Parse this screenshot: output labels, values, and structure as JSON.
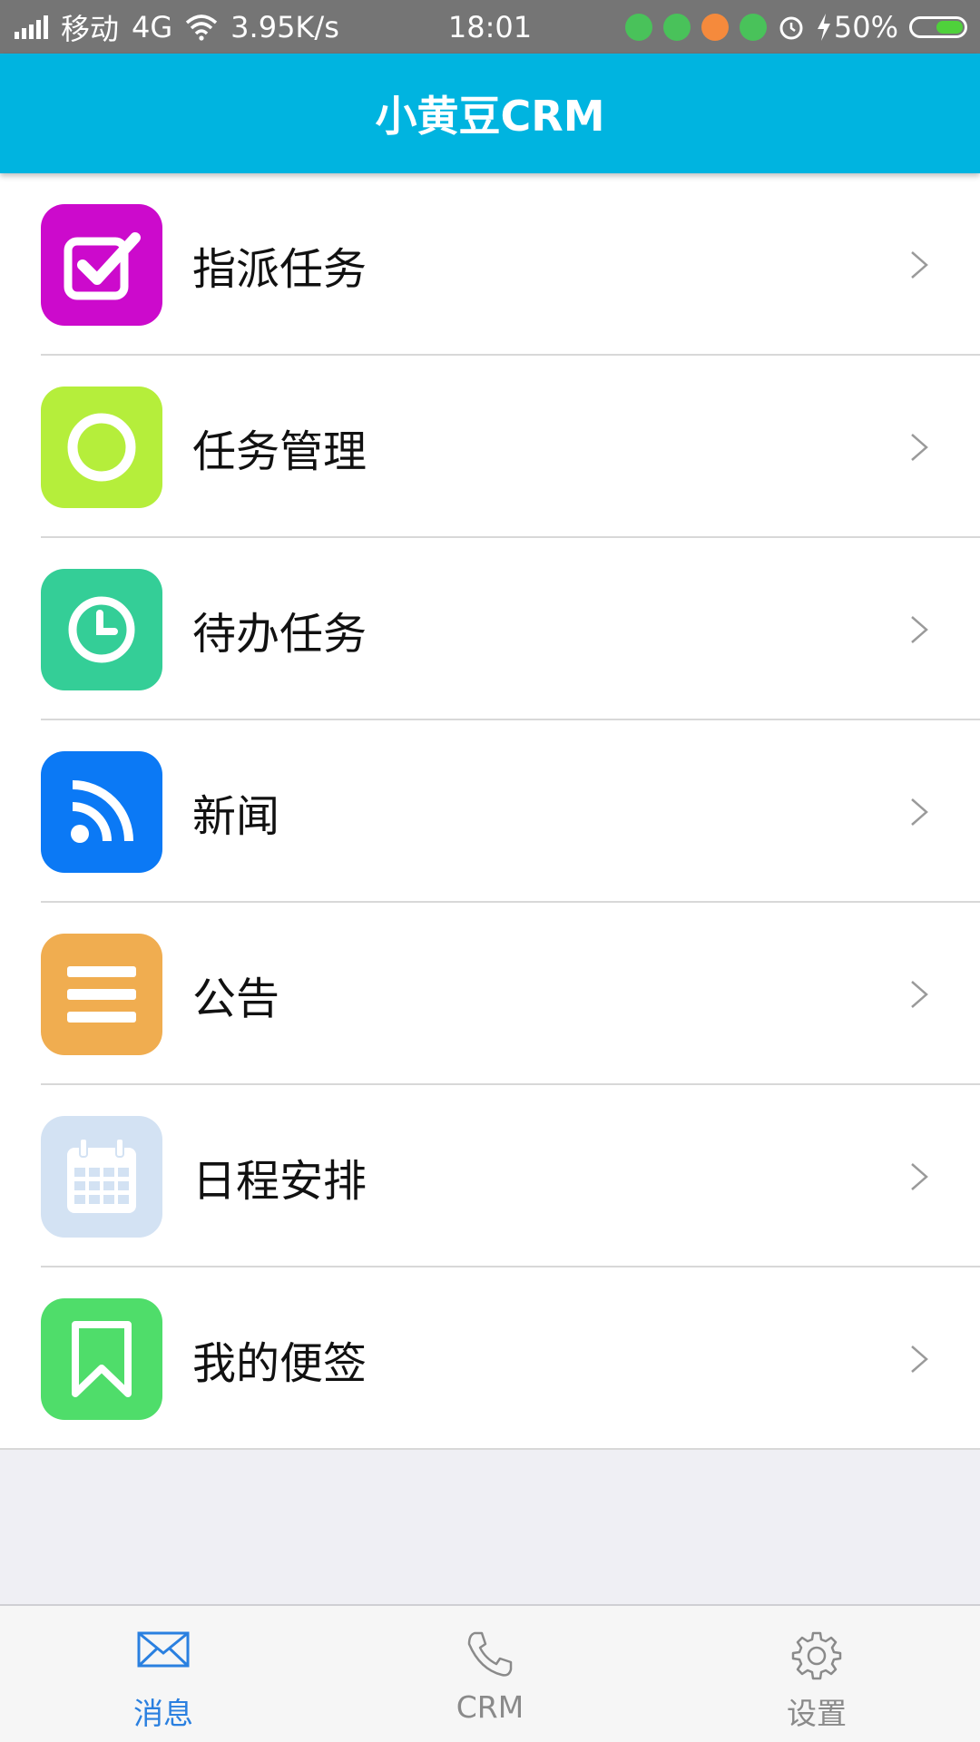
{
  "status_bar": {
    "carrier": "移动",
    "network": "4G",
    "speed": "3.95K/s",
    "time": "18:01",
    "battery": "50%",
    "battery_level": 0.5,
    "icons": [
      "signal-icon",
      "wifi-icon",
      "android-notif-icon",
      "battery-notif-icon",
      "orange-app-icon",
      "android-notif-icon",
      "alarm-icon",
      "charging-icon",
      "battery-icon"
    ]
  },
  "header": {
    "title": "小黄豆CRM"
  },
  "menu": [
    {
      "label": "指派任务",
      "icon": "checkbox-icon",
      "color": "#cc0acc"
    },
    {
      "label": "任务管理",
      "icon": "ring-icon",
      "color": "#b5ee3b"
    },
    {
      "label": "待办任务",
      "icon": "clock-icon",
      "color": "#34ce97"
    },
    {
      "label": "新闻",
      "icon": "rss-icon",
      "color": "#0b79f5"
    },
    {
      "label": "公告",
      "icon": "list-icon",
      "color": "#f0ad50"
    },
    {
      "label": "日程安排",
      "icon": "calendar-icon",
      "color": "#d3e2f3"
    },
    {
      "label": "我的便签",
      "icon": "bookmark-icon",
      "color": "#4fdd6a"
    }
  ],
  "tabs": [
    {
      "label": "消息",
      "icon": "mail-icon",
      "active": true
    },
    {
      "label": "CRM",
      "icon": "phone-icon",
      "active": false
    },
    {
      "label": "设置",
      "icon": "gear-icon",
      "active": false
    }
  ],
  "colors": {
    "accent": "#00b4e0",
    "tab_active": "#2a80e0",
    "tab_inactive": "#8a8a8a",
    "battery_fill": "#4fd13b"
  }
}
